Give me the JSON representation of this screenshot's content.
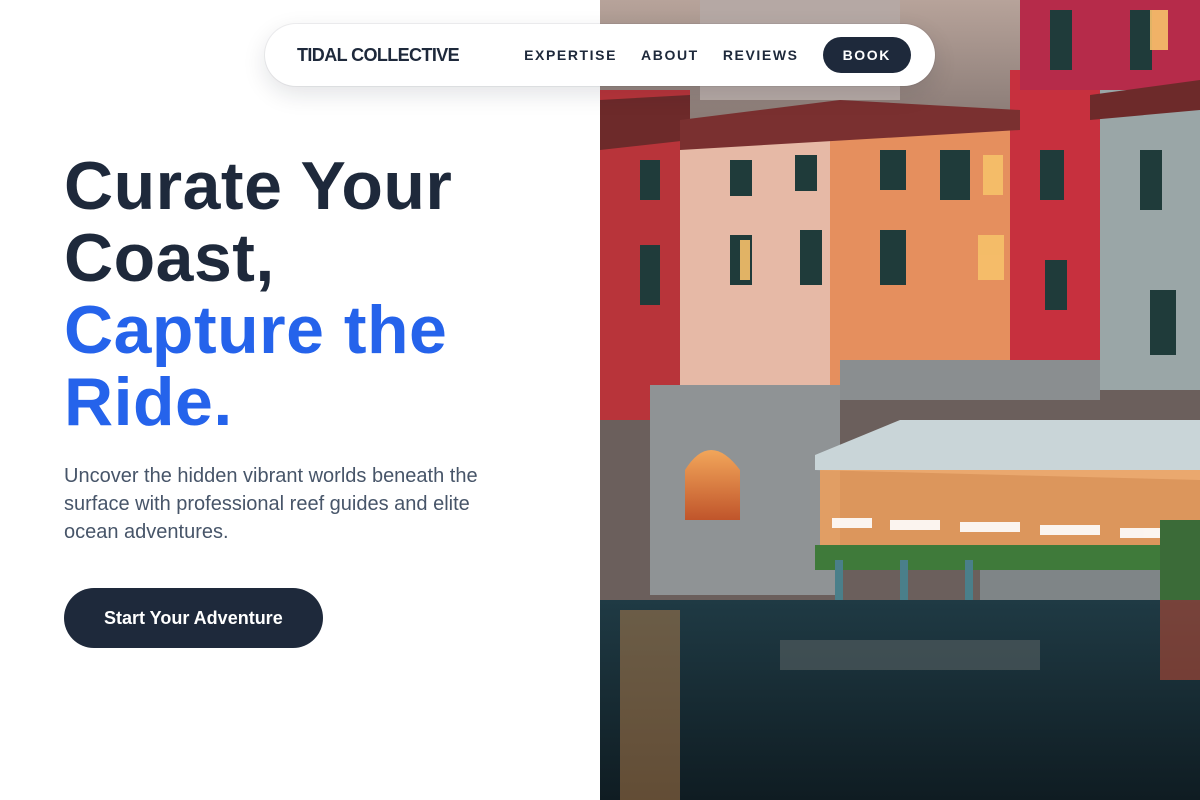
{
  "nav": {
    "brand": "TIDAL COLLECTIVE",
    "links": [
      "EXPERTISE",
      "ABOUT",
      "REVIEWS"
    ],
    "book_label": "BOOK"
  },
  "hero": {
    "headline_line1": "Curate Your",
    "headline_line2": "Coast,",
    "headline_line3": "Capture the",
    "headline_line4": "Ride.",
    "subtitle": "Uncover the hidden vibrant worlds beneath the surface with professional reef guides and elite ocean adventures.",
    "cta_label": "Start Your Adventure"
  },
  "photo": {
    "description_icon": "coastal-village-photo"
  },
  "colors": {
    "dark": "#1e293b",
    "accent": "#2563eb",
    "muted": "#475569"
  }
}
